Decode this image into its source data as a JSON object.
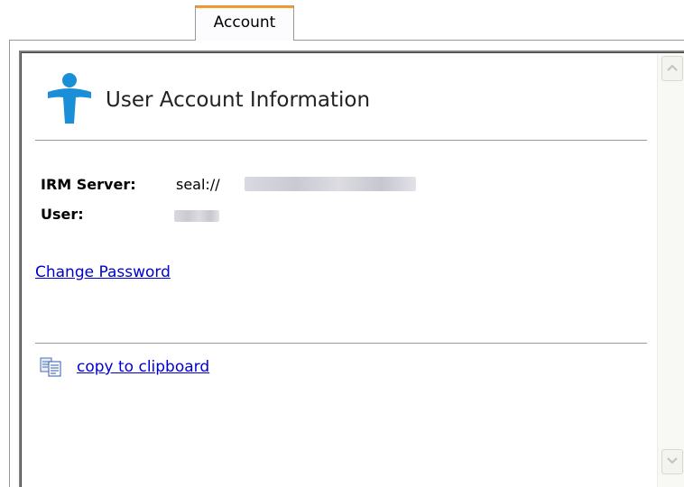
{
  "tabs": [
    {
      "label": "Account",
      "active": true
    }
  ],
  "header": {
    "title": "User Account Information",
    "icon": "user-icon"
  },
  "fields": {
    "irm_server": {
      "label": "IRM Server:",
      "value": "seal://"
    },
    "user": {
      "label": "User:",
      "value": ""
    }
  },
  "actions": {
    "change_password": "Change Password",
    "copy_to_clipboard": "copy to clipboard"
  },
  "colors": {
    "tab_accent": "#f0a030",
    "link": "#0000d0",
    "icon_blue": "#1a8fd8"
  }
}
